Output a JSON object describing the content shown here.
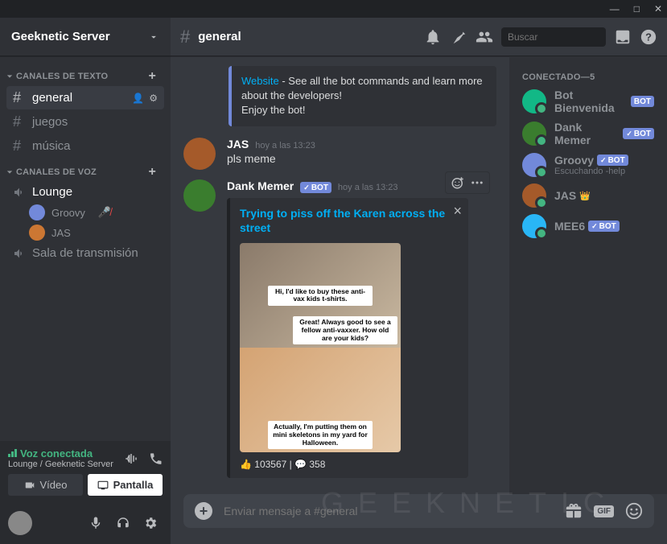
{
  "window": {
    "min": "—",
    "max": "□",
    "close": "✕"
  },
  "server": {
    "name": "Geeknetic Server"
  },
  "categories": {
    "text": {
      "label": "CANALES DE TEXTO"
    },
    "voice": {
      "label": "CANALES DE VOZ"
    }
  },
  "textChannels": [
    {
      "name": "general",
      "selected": true
    },
    {
      "name": "juegos",
      "selected": false
    },
    {
      "name": "música",
      "selected": false
    }
  ],
  "voiceChannels": [
    {
      "name": "Lounge",
      "users": [
        {
          "name": "Groovy",
          "color": "#7289da",
          "muted": true
        },
        {
          "name": "JAS",
          "color": "#cc7733",
          "muted": false
        }
      ]
    },
    {
      "name": "Sala de transmisión",
      "users": []
    }
  ],
  "voice": {
    "status": "Voz conectada",
    "sub": "Lounge / Geeknetic Server",
    "videoBtn": "Vídeo",
    "screenBtn": "Pantalla"
  },
  "chat": {
    "channel": "general",
    "searchPlaceholder": "Buscar",
    "inputPlaceholder": "Enviar mensaje a #general"
  },
  "pinnedEmbed": {
    "link": "Website",
    "body": " - See all the bot commands and learn more about the developers!",
    "footer": "Enjoy the bot!"
  },
  "messages": [
    {
      "author": "JAS",
      "ts": "hoy a las 13:23",
      "avatarColor": "#a55a2a",
      "text": "pls meme",
      "bot": false
    },
    {
      "author": "Dank Memer",
      "ts": "hoy a las 13:23",
      "avatarColor": "#3a7d2e",
      "bot": true,
      "embed": {
        "title": "Trying to piss off the Karen across the street",
        "captions": [
          "Hi, I'd like to buy these anti-vax kids t-shirts.",
          "Great! Always good to see a fellow anti-vaxxer. How old are your kids?",
          "Actually, I'm putting them on mini skeletons in my yard for Halloween."
        ],
        "reactions": "👍 103567 | 💬 358"
      }
    }
  ],
  "memberList": {
    "header": "CONECTADO—5",
    "members": [
      {
        "name": "Bot Bienvenida",
        "color": "#12b886",
        "bot": "BOT",
        "check": false
      },
      {
        "name": "Dank Memer",
        "color": "#3a7d2e",
        "bot": "BOT",
        "check": true
      },
      {
        "name": "Groovy",
        "color": "#7289da",
        "bot": "BOT",
        "check": true,
        "sub": "Escuchando -help"
      },
      {
        "name": "JAS",
        "color": "#a55a2a",
        "crown": true
      },
      {
        "name": "MEE6",
        "color": "#29b6f6",
        "bot": "BOT",
        "check": true
      }
    ]
  },
  "watermark": "GEEKNETIC"
}
